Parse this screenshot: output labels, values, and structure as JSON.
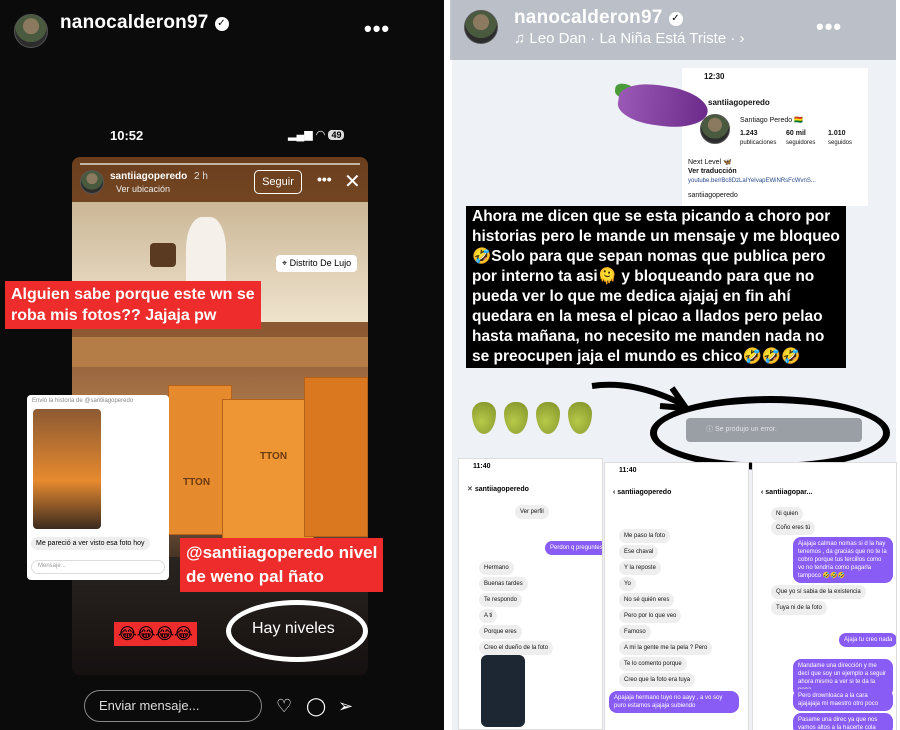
{
  "left": {
    "username": "nanocalderon97",
    "phone": {
      "time": "10:52",
      "battery": "49"
    },
    "story": {
      "user": "santiiagoperedo",
      "age": "2 h",
      "sub": "Ver ubicación",
      "follow": "Seguir",
      "location": "Distrito De Lujo",
      "bag_brand": "TTON",
      "bag_brand_2": "TTON"
    },
    "caption_top": [
      "Alguien sabe porque este wn se",
      "roba mis fotos?? Jajaja pw"
    ],
    "dm_card": {
      "header": "Envió la historia de @santiiagoperedo",
      "message": "Me pareció a ver visto esa foto hoy",
      "input": "Mensaje..."
    },
    "caption_mid": [
      "@santiiagoperedo  nivel",
      "de weno pal ñato"
    ],
    "emoji_row": "😂😂😂😂",
    "circled_text": "Hay niveles",
    "reply_placeholder": "Enviar mensaje..."
  },
  "right": {
    "username": "nanocalderon97",
    "music": "Leo Dan · La Niña Está Triste ·",
    "profile": {
      "time": "12:30",
      "handle": "santiiagoperedo",
      "name": "Santiago Peredo 🇧🇴",
      "posts": "1.243",
      "posts_label": "publicaciones",
      "followers": "60 mil",
      "followers_label": "seguidores",
      "following": "1.010",
      "following_label": "seguidos",
      "bio1": "Next Level 🦋",
      "bio2": "Ver traducción",
      "link": "youtube.be/rBc8DzLaIYeIvapEWiNRsFcWvnS...",
      "threads": "santiiagoperedo"
    },
    "caption": [
      "Ahora me dicen que se esta picando a choro por",
      "historias pero le mande un mensaje y me bloqueo",
      "🤣Solo para que sepan nomas que publica pero",
      "por interno ta asi🫠 y bloqueando para que no",
      "pueda ver lo que me dedica ajajaj en fin ahí",
      "quedara en la mesa el picao a llados pero pelao",
      "hasta mañana, no necesito me manden nada no",
      "se preocupen jaja el mundo es chico🤣🤣🤣"
    ],
    "error_text": "Se produjo un error.",
    "chat1": {
      "time": "11:40",
      "name": "santiiagoperedo",
      "msgs": [
        "Ver perfil",
        "Perdon q preguntes",
        "Hermano",
        "Buenas tardes",
        "Te respondo",
        "A ti",
        "Porque eres",
        "Creo el dueño de la foto"
      ]
    },
    "chat2": {
      "time": "11:40",
      "name": "santiiagoperedo",
      "msgs": [
        "Me paso la foto",
        "Ese chaval",
        "Y la reposte",
        "Yo",
        "No sé quién eres",
        "Pero por lo que veo",
        "Famoso",
        "A mi la gente me la pela ? Pero",
        "Te lo comento porque",
        "Creo que la foto era tuya",
        "Apajaja hermano tuyo no aayy , a vo soy puro estamos ajajaja subiendo"
      ]
    },
    "chat3": {
      "name": "santiiagopar...",
      "msgs": [
        "Ni quien",
        "Coño eres tú",
        "Ajajaja calmao nomas si d la hay tenemos , da gracias que no te la cobro porque tus tercillos como vo no tendría como pagarla tampoco 🤣🤣🤣",
        "Que yo sí sabia de la existencia",
        "Tuya ni de la foto",
        "Ajaja tu creo nada",
        "Mandame una dirección y me decí que soy un ejemplo a seguir ahora mismo a ver si te da la pena",
        "Pero drownloaca a la cara ajajajaja mi maestro otro poco",
        "Pasame una direc ya que nos vamos altos a la hacerte cola"
      ]
    }
  }
}
